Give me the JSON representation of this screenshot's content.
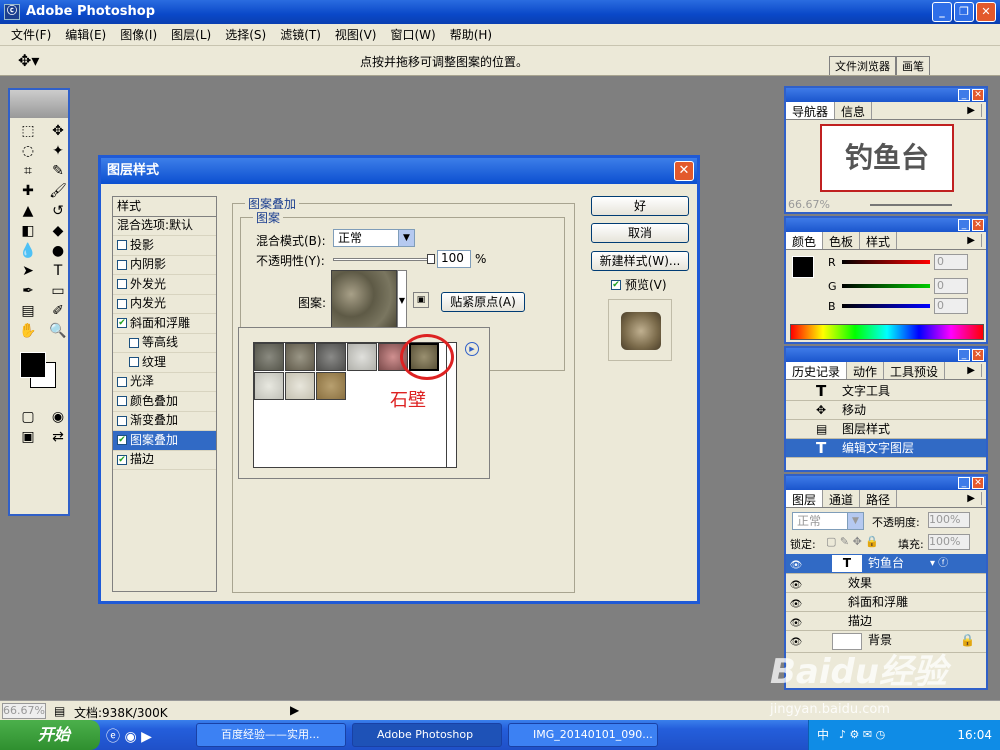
{
  "app": {
    "title": "Adobe Photoshop",
    "logo_letter": "ⓒ"
  },
  "menu": [
    "文件(F)",
    "编辑(E)",
    "图像(I)",
    "图层(L)",
    "选择(S)",
    "滤镜(T)",
    "视图(V)",
    "窗口(W)",
    "帮助(H)"
  ],
  "options": {
    "hint": "点按并拖移可调整图案的位置。",
    "tabs": [
      "文件浏览器",
      "画笔"
    ]
  },
  "dialog": {
    "title": "图层样式",
    "styles_header": "样式",
    "blend_default": "混合选项:默认",
    "styles": [
      {
        "label": "投影",
        "checked": false
      },
      {
        "label": "内阴影",
        "checked": false
      },
      {
        "label": "外发光",
        "checked": false
      },
      {
        "label": "内发光",
        "checked": false
      },
      {
        "label": "斜面和浮雕",
        "checked": true
      },
      {
        "label": "等高线",
        "checked": false
      },
      {
        "label": "纹理",
        "checked": false
      },
      {
        "label": "光泽",
        "checked": false
      },
      {
        "label": "颜色叠加",
        "checked": false
      },
      {
        "label": "渐变叠加",
        "checked": false
      },
      {
        "label": "图案叠加",
        "checked": true
      },
      {
        "label": "描边",
        "checked": true
      }
    ],
    "group_title": "图案叠加",
    "sub_title": "图案",
    "blend_label": "混合模式(B):",
    "blend_value": "正常",
    "opacity_label": "不透明性(Y):",
    "opacity_value": "100",
    "opacity_unit": "%",
    "pattern_label": "图案:",
    "snap_button": "贴紧原点(A)",
    "ok": "好",
    "cancel": "取消",
    "new_style": "新建样式(W)...",
    "preview_label": "预览(V)",
    "annotation": "石壁"
  },
  "navigator": {
    "tabs": [
      "导航器",
      "信息"
    ],
    "zoom": "66.67%",
    "preview_text": "钓鱼台"
  },
  "color_panel": {
    "tabs": [
      "颜色",
      "色板",
      "样式"
    ],
    "channels": [
      {
        "name": "R",
        "value": "0"
      },
      {
        "name": "G",
        "value": "0"
      },
      {
        "name": "B",
        "value": "0"
      }
    ]
  },
  "history": {
    "tabs": [
      "历史记录",
      "动作",
      "工具预设"
    ],
    "items": [
      "文字工具",
      "移动",
      "图层样式",
      "编辑文字图层"
    ]
  },
  "layers": {
    "tabs": [
      "图层",
      "通道",
      "路径"
    ],
    "blend": "正常",
    "opacity_label": "不透明度:",
    "opacity_value": "100%",
    "lock_label": "锁定:",
    "fill_label": "填充:",
    "fill_value": "100%",
    "text_layer": "钓鱼台",
    "effects_label": "效果",
    "effects": [
      "斜面和浮雕",
      "描边"
    ],
    "background": "背景"
  },
  "status": {
    "zoom": "66.67%",
    "doc": "文档:938K/300K"
  },
  "taskbar": {
    "start": "开始",
    "tasks": [
      "百度经验——实用...",
      "Adobe Photoshop",
      "IMG_20140101_090..."
    ],
    "lang": "中",
    "clock": "16:04"
  },
  "watermark": {
    "logo": "Baidu经验",
    "url": "jingyan.baidu.com"
  }
}
